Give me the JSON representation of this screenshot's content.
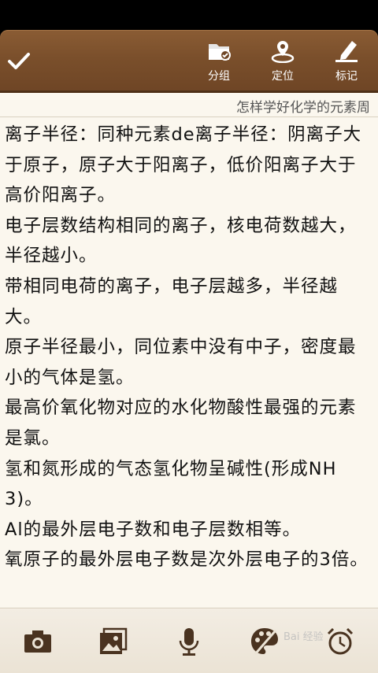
{
  "status_bar": {
    "clock": ""
  },
  "toolbar": {
    "confirm_icon": "checkmark-icon",
    "buttons": [
      {
        "label": "分组",
        "icon": "folder-check-icon"
      },
      {
        "label": "定位",
        "icon": "location-pin-icon"
      },
      {
        "label": "标记",
        "icon": "pen-mark-icon"
      }
    ]
  },
  "note": {
    "title": "怎样学好化学的元素周",
    "body": "离子半径：同种元素de离子半径：阴离子大于原子，原子大于阳离子，低价阳离子大于高价阳离子。\n电子层数结构相同的离子，核电荷数越大，半径越小。\n带相同电荷的离子，电子层越多，半径越大。\n原子半径最小，同位素中没有中子，密度最小的气体是氢。\n最高价氧化物对应的水化物酸性最强的元素是氯。\n氢和氮形成的气态氢化物呈碱性(形成NH3)。\nAl的最外层电子数和电子层数相等。\n氧原子的最外层电子数是次外层电子的3倍。"
  },
  "bottom_bar": {
    "buttons": [
      "camera-icon",
      "image-icon",
      "microphone-icon",
      "paint-palette-icon",
      "alarm-clock-icon"
    ]
  },
  "watermark": "Bai 经验"
}
